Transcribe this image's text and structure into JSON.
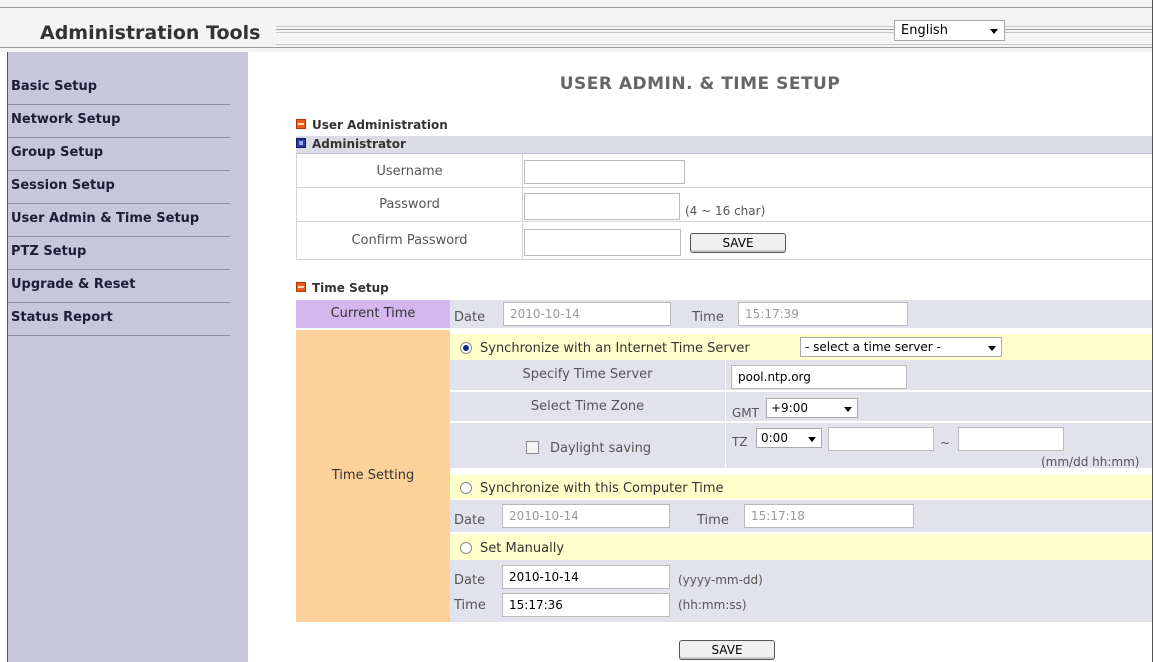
{
  "header": {
    "app_title": "Administration Tools",
    "language": "English"
  },
  "sidebar": {
    "items": [
      {
        "label": "Basic Setup"
      },
      {
        "label": "Network Setup"
      },
      {
        "label": "Group Setup"
      },
      {
        "label": "Session Setup"
      },
      {
        "label": "User Admin & Time Setup"
      },
      {
        "label": "PTZ Setup"
      },
      {
        "label": "Upgrade & Reset"
      },
      {
        "label": "Status Report"
      }
    ]
  },
  "page": {
    "title": "USER ADMIN. & TIME SETUP"
  },
  "user_admin": {
    "heading": "User Administration",
    "subheading": "Administrator",
    "username_label": "Username",
    "username_value": "",
    "password_label": "Password",
    "password_value": "",
    "password_hint": "(4 ~ 16 char)",
    "confirm_label": "Confirm Password",
    "confirm_value": "",
    "save_label": "SAVE"
  },
  "time_setup": {
    "heading": "Time Setup",
    "current_time_label": "Current Time",
    "current_date_label": "Date",
    "current_date": "2010-10-14",
    "current_time_field_label": "Time",
    "current_time": "15:17:39",
    "time_setting_label": "Time Setting",
    "sync_internet_label": "Synchronize with an Internet Time Server",
    "time_server_select": "- select a time server -",
    "specify_server_label": "Specify Time Server",
    "specify_server_value": "pool.ntp.org",
    "timezone_label": "Select Time Zone",
    "gmt_label": "GMT",
    "gmt_value": "+9:00",
    "daylight_label": "Daylight saving",
    "tz_label": "TZ",
    "tz_value": "0:00",
    "dst_start": "",
    "dst_tilde": "~",
    "dst_end": "",
    "dst_format": "(mm/dd hh:mm)",
    "sync_computer_label": "Synchronize with this Computer Time",
    "computer_date_label": "Date",
    "computer_date": "2010-10-14",
    "computer_time_label": "Time",
    "computer_time": "15:17:18",
    "manual_label": "Set Manually",
    "manual_date_label": "Date",
    "manual_date": "2010-10-14",
    "manual_date_format": "(yyyy-mm-dd)",
    "manual_time_label": "Time",
    "manual_time": "15:17:36",
    "manual_time_format": "(hh:mm:ss)",
    "save_label": "SAVE"
  },
  "colors": {
    "sidebar_bg": "#c7c6dc",
    "current_time_row": "#d4b7ef",
    "time_setting_cell": "#ffd19a",
    "radio_row": "#ffffcc",
    "sub_row": "#e2e2ec"
  }
}
